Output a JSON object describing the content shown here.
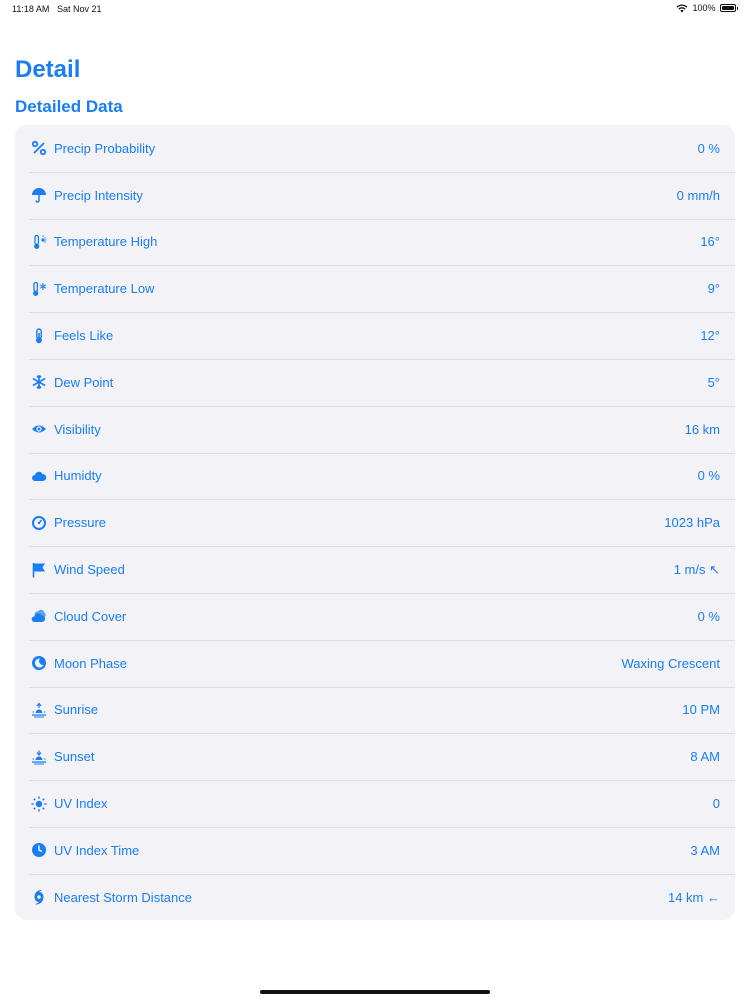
{
  "status_bar": {
    "time": "11:18 AM",
    "date": "Sat Nov 21",
    "battery": "100%"
  },
  "page": {
    "title": "Detail",
    "section_title": "Detailed Data"
  },
  "rows": [
    {
      "icon": "percent-icon",
      "label": "Precip Probability",
      "value": "0 %"
    },
    {
      "icon": "umbrella-icon",
      "label": "Precip Intensity",
      "value": "0 mm/h"
    },
    {
      "icon": "thermometer-sun-icon",
      "label": "Temperature High",
      "value": "16°"
    },
    {
      "icon": "thermometer-snowflake-icon",
      "label": "Temperature Low",
      "value": "9°"
    },
    {
      "icon": "thermometer-icon",
      "label": "Feels Like",
      "value": "12°"
    },
    {
      "icon": "snowflake-icon",
      "label": "Dew Point",
      "value": "5°"
    },
    {
      "icon": "eye-icon",
      "label": "Visibility",
      "value": "16 km"
    },
    {
      "icon": "cloud-icon",
      "label": "Humidty",
      "value": "0 %"
    },
    {
      "icon": "gauge-icon",
      "label": "Pressure",
      "value": "1023 hPa"
    },
    {
      "icon": "flag-icon",
      "label": "Wind Speed",
      "value": "1 m/s ↖"
    },
    {
      "icon": "cloud-fill-icon",
      "label": "Cloud Cover",
      "value": "0 %"
    },
    {
      "icon": "moon-icon",
      "label": "Moon Phase",
      "value": "Waxing Crescent"
    },
    {
      "icon": "sunrise-icon",
      "label": "Sunrise",
      "value": "10 PM"
    },
    {
      "icon": "sunset-icon",
      "label": "Sunset",
      "value": "8 AM"
    },
    {
      "icon": "sun-icon",
      "label": "UV Index",
      "value": "0"
    },
    {
      "icon": "clock-icon",
      "label": "UV Index Time",
      "value": "3 AM"
    },
    {
      "icon": "hurricane-icon",
      "label": "Nearest Storm Distance",
      "value": "14 km ←"
    }
  ]
}
